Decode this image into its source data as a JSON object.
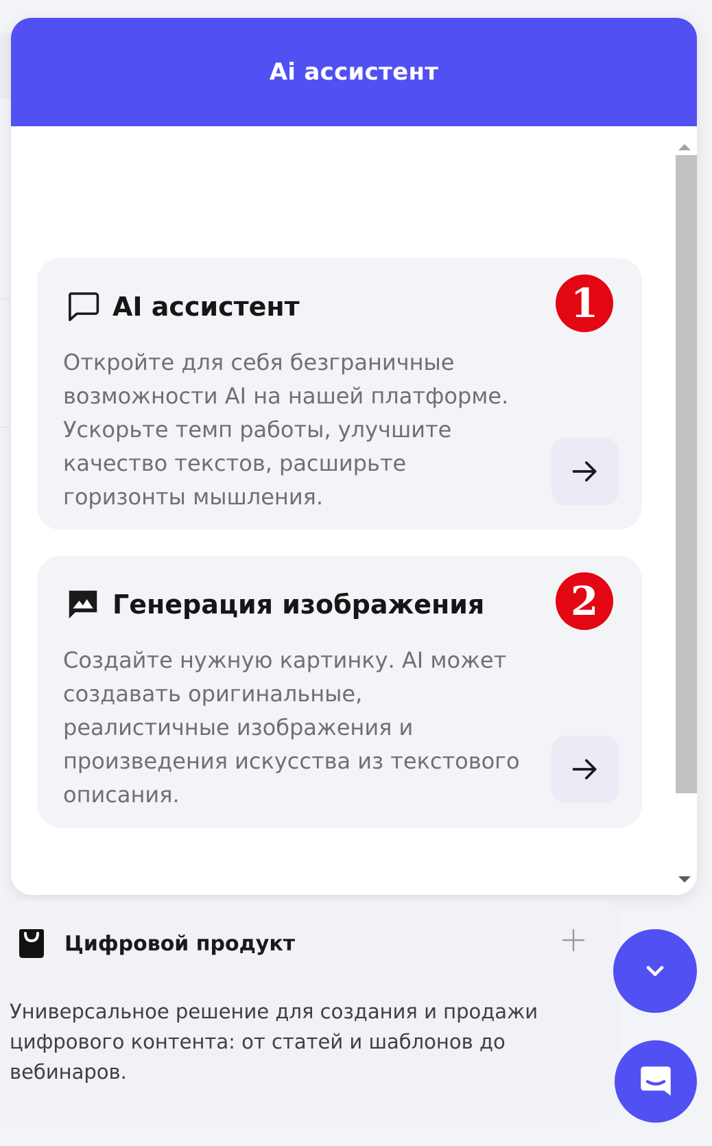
{
  "popup": {
    "title": "Ai ассистент"
  },
  "cards": [
    {
      "title": "AI ассистент",
      "badge": "1",
      "description": "Откройте для себя безграничные возможности AI на нашей платформе. Ускорьте темп работы, улучшите качество текстов, расширьте горизонты мышления.",
      "icon": "chat-bubble-icon",
      "action_icon": "arrow-right-icon"
    },
    {
      "title": "Генерация изображения",
      "badge": "2",
      "description": "Создайте нужную картинку. AI может создавать оригинальные, реалистичные изображения и произведения искусства из текстового описания.",
      "icon": "image-icon",
      "action_icon": "arrow-right-icon"
    }
  ],
  "product": {
    "title": "Цифровой продукт",
    "description": "Универсальное решение для создания и продажи цифрового контента: от статей и шаблонов до вебинаров.",
    "icon": "shopping-bag-icon",
    "expand_icon": "plus-icon"
  },
  "fabs": {
    "scroll_icon": "chevron-down-icon",
    "chat_icon": "chat-messenger-icon"
  },
  "colors": {
    "accent": "#5150f3",
    "badge": "#e30613",
    "card_bg": "#f3f4f7",
    "text_muted": "#707074"
  }
}
